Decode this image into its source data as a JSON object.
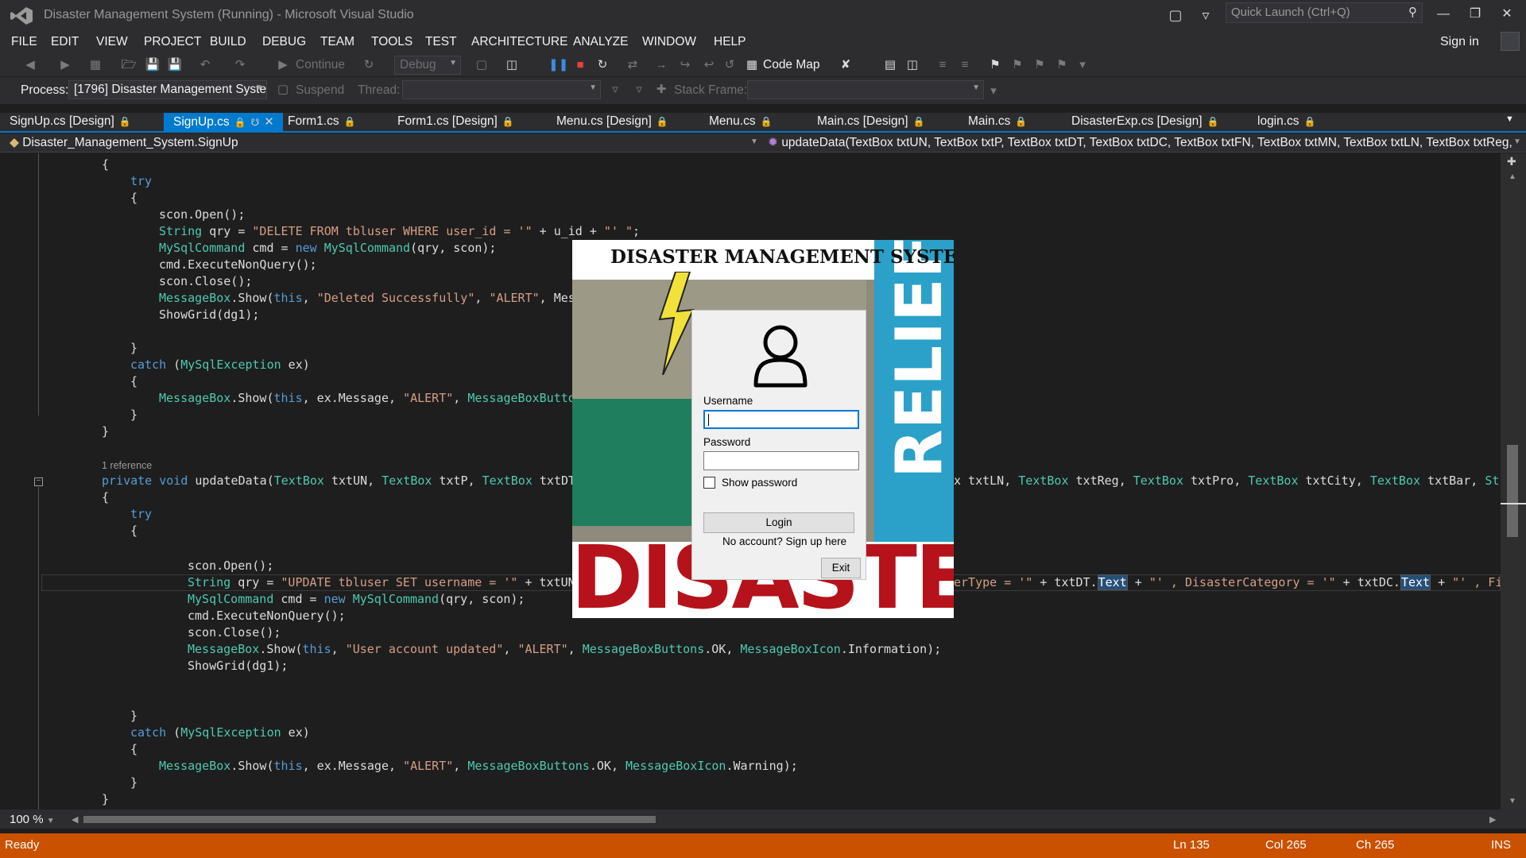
{
  "window": {
    "title": "Disaster Management System (Running) - Microsoft Visual Studio",
    "quick_launch_placeholder": "Quick Launch (Ctrl+Q)",
    "sign_in": "Sign in"
  },
  "menu": [
    "FILE",
    "EDIT",
    "VIEW",
    "PROJECT",
    "BUILD",
    "DEBUG",
    "TEAM",
    "TOOLS",
    "TEST",
    "ARCHITECTURE",
    "ANALYZE",
    "WINDOW",
    "HELP"
  ],
  "toolbar": {
    "continue": "Continue",
    "config": "Debug",
    "code_map": "Code Map",
    "process_label": "Process:",
    "process_value": "[1796] Disaster Management Syste",
    "suspend": "Suspend",
    "thread_label": "Thread:",
    "stack_frame_label": "Stack Frame:"
  },
  "tabs": [
    {
      "label": "SignUp.cs [Design]"
    },
    {
      "label": "SignUp.cs"
    },
    {
      "label": "Form1.cs"
    },
    {
      "label": "Form1.cs [Design]"
    },
    {
      "label": "Menu.cs [Design]"
    },
    {
      "label": "Menu.cs"
    },
    {
      "label": "Main.cs [Design]"
    },
    {
      "label": "Main.cs"
    },
    {
      "label": "DisasterExp.cs [Design]"
    },
    {
      "label": "login.cs"
    }
  ],
  "navbar": {
    "class_path": "Disaster_Management_System.SignUp",
    "member": "updateData(TextBox txtUN, TextBox txtP, TextBox txtDT, TextBox txtDC, TextBox txtFN, TextBox txtMN, TextBox txtLN, TextBox txtReg, TextBox txtPro, TextBox txtCity, TextBox txtBar, Str"
  },
  "code": {
    "l1": "{",
    "l2": "try",
    "l3": "{",
    "l4": "scon.Open();",
    "l5a": "String",
    "l5b": " qry = ",
    "l5c": "\"DELETE FROM tbluser WHERE user_id = '\"",
    "l5d": " + u_id + ",
    "l5e": "\"' \"",
    "l5f": ";",
    "l6a": "MySqlCommand",
    "l6b": " cmd = ",
    "l6c": "new",
    "l6d": "MySqlCommand",
    "l6e": "(qry, scon);",
    "l7": "cmd.ExecuteNonQuery();",
    "l8": "scon.Close();",
    "l9a": "MessageBox",
    "l9b": ".Show(",
    "l9c": "this",
    "l9d": ", ",
    "l9e": "\"Deleted Successfully\"",
    "l9f": ", ",
    "l9g": "\"ALERT\"",
    "l9h": ", Mes",
    "l10": "ShowGrid(dg1);",
    "l11": "}",
    "l12a": "catch",
    "l12b": " (",
    "l12c": "MySqlException",
    "l12d": " ex)",
    "l13": "{",
    "l14a": "MessageBox",
    "l14b": ".Show(",
    "l14c": "this",
    "l14d": ", ex.Message, ",
    "l14e": "\"ALERT\"",
    "l14f": ", ",
    "l14g": "MessageBoxButto",
    "l15": "}",
    "l16": "}",
    "ref": "1 reference",
    "sig_a": "private",
    "sig_b": "void",
    "sig_c": " updateData(",
    "sig_d": "TextBox",
    "sig_e": " txtUN, ",
    "sig_f": "TextBox",
    "sig_g": " txtP, ",
    "sig_h": "TextBox",
    "sig_i": " txtDT",
    "sig_r1": "x txtLN, ",
    "sig_r2": "TextBox",
    "sig_r3": " txtReg, ",
    "sig_r4": "TextBox",
    "sig_r5": " txtPro, ",
    "sig_r6": "TextBox",
    "sig_r7": " txtCity, ",
    "sig_r8": "TextBox",
    "sig_r9": " txtBar, ",
    "sig_r10": "Str",
    "l18": "{",
    "l19": "try",
    "l20": "{",
    "l21": "scon.Open();",
    "l22a": "String",
    "l22b": " qry = ",
    "l22c": "\"UPDATE tbluser SET username = '\"",
    "l22d": " + txtUN",
    "l22r1": "erType = '\"",
    "l22r2": " + txtDT.",
    "l22r3": "Text",
    "l22r4": " + ",
    "l22r5": "\"' , DisasterCategory = '\"",
    "l22r6": " + txtDC.",
    "l22r7": "Text",
    "l22r8": " + ",
    "l22r9": "\"' , Fir",
    "l23a": "MySqlCommand",
    "l23b": " cmd = ",
    "l23c": "new",
    "l23d": "MySqlCommand",
    "l23e": "(qry, scon);",
    "l24": "cmd.ExecuteNonQuery();",
    "l25": "scon.Close();",
    "l26a": "MessageBox",
    "l26b": ".Show(",
    "l26c": "this",
    "l26d": ", ",
    "l26e": "\"User account updated\"",
    "l26f": ", ",
    "l26g": "\"ALERT\"",
    "l26h": ", ",
    "l26i": "MessageBoxButtons",
    "l26j": ".OK, ",
    "l26k": "MessageBoxIcon",
    "l26l": ".Information);",
    "l27": "ShowGrid(dg1);",
    "l28": "}",
    "l29a": "catch",
    "l29b": " (",
    "l29c": "MySqlException",
    "l29d": " ex)",
    "l30": "{",
    "l31a": "MessageBox",
    "l31b": ".Show(",
    "l31c": "this",
    "l31d": ", ex.Message, ",
    "l31e": "\"ALERT\"",
    "l31f": ", ",
    "l31g": "MessageBoxButtons",
    "l31h": ".OK, ",
    "l31i": "MessageBoxIcon",
    "l31j": ".Warning);",
    "l32": "}",
    "l33": "}"
  },
  "zoom": "100 %",
  "status": {
    "ready": "Ready",
    "ln": "Ln 135",
    "col": "Col 265",
    "ch": "Ch 265",
    "ins": "INS"
  },
  "login": {
    "banner_title": "DISASTER MANAGEMENT SYSTEM",
    "relief_text": "RELIEF",
    "disaster_text": "DISASTER",
    "username_label": "Username",
    "username_value": "",
    "password_label": "Password",
    "show_password_label": "Show password",
    "login_button": "Login",
    "signup_link": "No account? Sign up here",
    "exit_button": "Exit"
  }
}
